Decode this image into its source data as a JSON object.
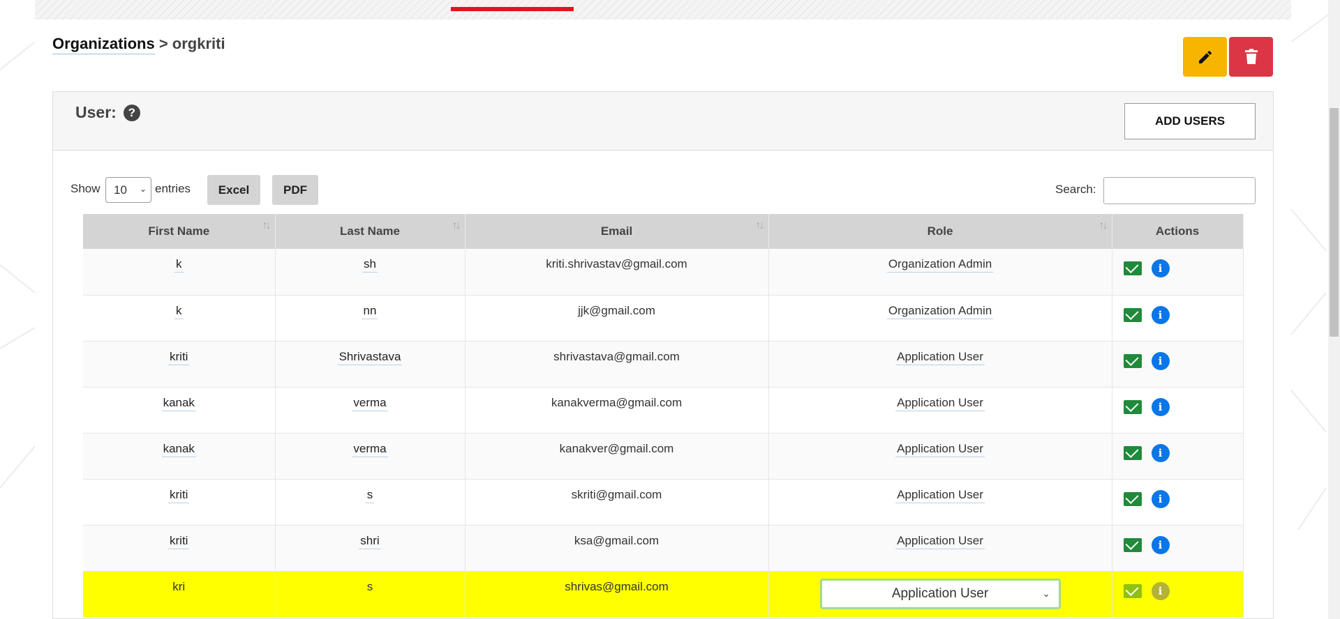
{
  "breadcrumb": {
    "root": "Organizations",
    "separator": ">",
    "current": "orgkriti"
  },
  "card": {
    "title": "User:",
    "add_users_label": "ADD USERS"
  },
  "controls": {
    "show_label": "Show",
    "entries_value": "10",
    "entries_label": "entries",
    "excel_label": "Excel",
    "pdf_label": "PDF",
    "search_label": "Search:",
    "search_value": ""
  },
  "table": {
    "headers": [
      "First Name",
      "Last Name",
      "Email",
      "Role",
      "Actions"
    ],
    "rows": [
      {
        "first": "k",
        "last": "sh",
        "email": "kriti.shrivastav@gmail.com",
        "role": "Organization Admin"
      },
      {
        "first": "k",
        "last": "nn",
        "email": "jjk@gmail.com",
        "role": "Organization Admin"
      },
      {
        "first": "kriti",
        "last": "Shrivastava",
        "email": "shrivastava@gmail.com",
        "role": "Application User"
      },
      {
        "first": "kanak",
        "last": "verma",
        "email": "kanakverma@gmail.com",
        "role": "Application User"
      },
      {
        "first": "kanak",
        "last": "verma",
        "email": "kanakver@gmail.com",
        "role": "Application User"
      },
      {
        "first": "kriti",
        "last": "s",
        "email": "skriti@gmail.com",
        "role": "Application User"
      },
      {
        "first": "kriti",
        "last": "shri",
        "email": "ksa@gmail.com",
        "role": "Application User"
      },
      {
        "first": "kri",
        "last": "s",
        "email": "shrivas@gmail.com",
        "role": "Application User"
      }
    ]
  },
  "icons": {
    "edit": "pencil-icon",
    "delete": "trash-icon",
    "help": "question-circle-icon",
    "mail": "envelope-icon",
    "info": "info-circle-icon",
    "sort": "sort-arrows-icon"
  },
  "colors": {
    "accent_red": "#e3131b",
    "edit_button": "#f7b500",
    "delete_button": "#dc3545",
    "mail_icon": "#1f8a3a",
    "info_icon": "#0a76e8",
    "selected_row": "#ffff00"
  }
}
